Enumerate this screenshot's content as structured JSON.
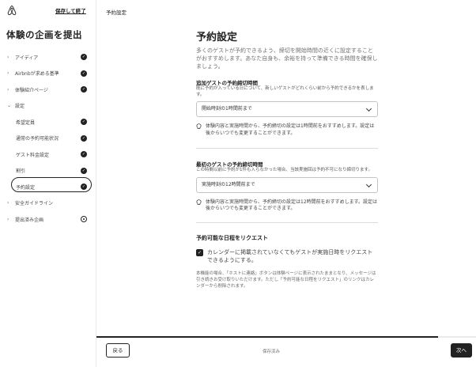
{
  "sidebar": {
    "save_exit": "保存して終了",
    "title": "体験の企画を提出",
    "items": [
      {
        "label": "アイディア",
        "status": "done",
        "expanded": false
      },
      {
        "label": "Airbnbが求める基準",
        "status": "done",
        "expanded": false
      },
      {
        "label": "体験紹介ページ",
        "status": "done",
        "expanded": false
      },
      {
        "label": "設定",
        "status": "",
        "expanded": true
      },
      {
        "label": "希望定員",
        "status": "done",
        "sub": true
      },
      {
        "label": "通常の予約可能状況",
        "status": "done",
        "sub": true
      },
      {
        "label": "ゲスト料金設定",
        "status": "done",
        "sub": true
      },
      {
        "label": "割引",
        "status": "done",
        "sub": true
      },
      {
        "label": "予約設定",
        "status": "done",
        "sub": true,
        "active": true
      },
      {
        "label": "安全ガイドライン",
        "status": "",
        "expanded": false
      },
      {
        "label": "提出済み企画",
        "status": "pending",
        "expanded": false
      }
    ]
  },
  "breadcrumb": "予約設定",
  "page": {
    "title": "予約設定",
    "lead": "多くのゲストが予約できるよう、締切を開始時間の近くに設定することがおすすめします。あなた自身も、余裕を持って準備できる時間を確保しましょう。",
    "section1": {
      "title": "追加ゲストの予約締切時間",
      "desc": "既に予約が入っている日について、新しいゲストがどれくらい前から予約できるかを表します。",
      "select_value": "開始時刻の1時間前まで",
      "tip": "体験内容と実施時間から、予約締切の設定は1時間前をおすすめします。設定は後からいつでも変更することができます。"
    },
    "section2": {
      "title": "最初のゲストの予約締切時間",
      "desc": "この時間以前に予約が1件も入らなかった場合、当該実施回は予約不可になり締切ります。",
      "select_value": "実施時刻の12時間前まで",
      "tip": "体験内容と実施時間から、予約締切の設定は12時間前をおすすめします。設定は後からいつでも変更することができます。"
    },
    "section3": {
      "title": "予約可能な日程をリクエスト",
      "checkbox_label": "カレンダーに掲載されていなくてもゲストが実施日時をリクエストできるようにする。",
      "checked": true,
      "note": "本機能の場合、「ホストに連絡」ボタンは体験ページに表示されたままとなり、メッセージは引き続きお受け取りいただけます。ただし「予約可能な日程をリクエスト」のリンクはカレンダーから削除されます。"
    }
  },
  "footer": {
    "back_label": "戻る",
    "status": "保存済み",
    "next_label": "次へ",
    "progress": 0.9
  },
  "colors": {
    "accent": "#222222",
    "brand": "#222222"
  }
}
